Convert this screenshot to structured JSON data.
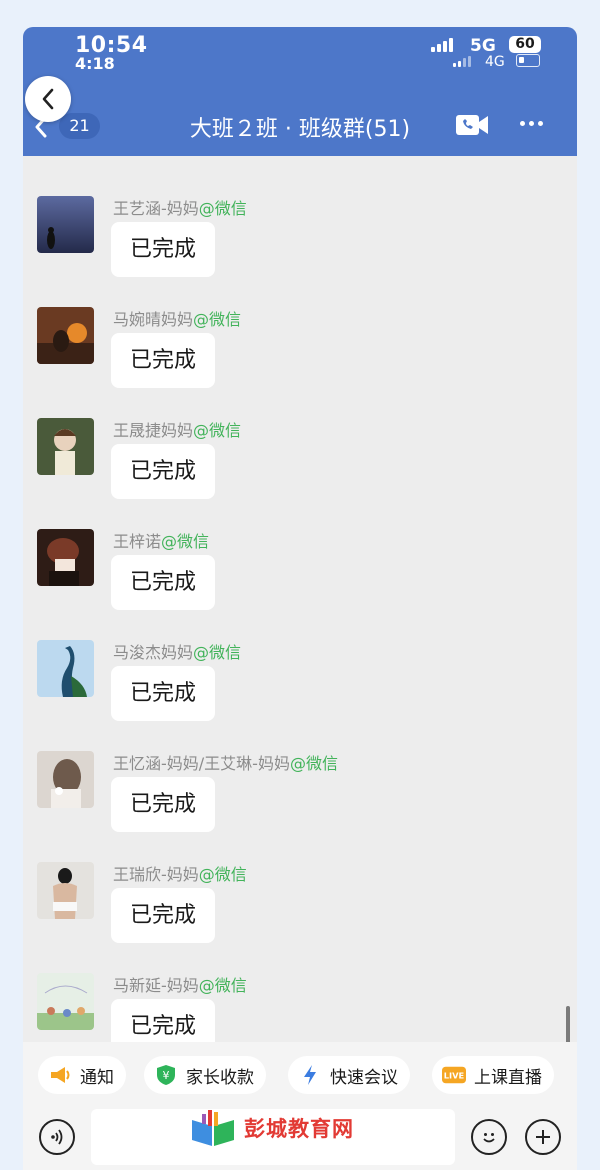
{
  "status_bar": {
    "time_primary": "10:54",
    "time_secondary": "4:18",
    "network_primary": "5G",
    "network_secondary": "4G",
    "battery_level": "60"
  },
  "header": {
    "unread_count": "21",
    "title": "大班２班 · 班级群(51)",
    "back_icon": "chevron-left-icon",
    "video_icon": "video-call-icon",
    "more_icon": "more-icon"
  },
  "messages": [
    {
      "sender": "王艺涵-妈妈",
      "tag": "@微信",
      "text": "已完成"
    },
    {
      "sender": "马婉晴妈妈",
      "tag": "@微信",
      "text": "已完成"
    },
    {
      "sender": "王晟捷妈妈",
      "tag": "@微信",
      "text": "已完成"
    },
    {
      "sender": "王梓诺",
      "tag": "@微信",
      "text": "已完成"
    },
    {
      "sender": "马浚杰妈妈",
      "tag": "@微信",
      "text": "已完成"
    },
    {
      "sender": "王忆涵-妈妈/王艾琳-妈妈",
      "tag": "@微信",
      "text": "已完成"
    },
    {
      "sender": "王瑞欣-妈妈",
      "tag": "@微信",
      "text": "已完成"
    },
    {
      "sender": "马新延-妈妈",
      "tag": "@微信",
      "text": "已完成"
    }
  ],
  "quick_actions": [
    {
      "label": "通知",
      "icon": "megaphone-icon",
      "color": "#f5a623"
    },
    {
      "label": "家长收款",
      "icon": "payment-icon",
      "color": "#2eb45a"
    },
    {
      "label": "快速会议",
      "icon": "lightning-icon",
      "color": "#3b7ce0"
    },
    {
      "label": "上课直播",
      "icon": "live-icon",
      "color": "#f5a623"
    }
  ],
  "input_bar": {
    "voice_icon": "voice-icon",
    "emoji_icon": "emoji-icon",
    "plus_icon": "plus-icon"
  },
  "watermark": {
    "text": "彭城教育网"
  },
  "colors": {
    "header": "#4d77c9",
    "tag": "#42b35a",
    "watermark": "#e23a34"
  }
}
